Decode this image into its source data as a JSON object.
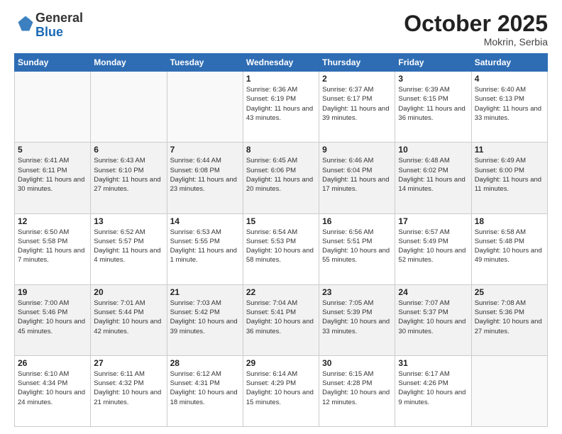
{
  "header": {
    "logo_general": "General",
    "logo_blue": "Blue",
    "month": "October 2025",
    "location": "Mokrin, Serbia"
  },
  "days_of_week": [
    "Sunday",
    "Monday",
    "Tuesday",
    "Wednesday",
    "Thursday",
    "Friday",
    "Saturday"
  ],
  "weeks": [
    [
      {
        "day": "",
        "sunrise": "",
        "sunset": "",
        "daylight": ""
      },
      {
        "day": "",
        "sunrise": "",
        "sunset": "",
        "daylight": ""
      },
      {
        "day": "",
        "sunrise": "",
        "sunset": "",
        "daylight": ""
      },
      {
        "day": "1",
        "sunrise": "Sunrise: 6:36 AM",
        "sunset": "Sunset: 6:19 PM",
        "daylight": "Daylight: 11 hours and 43 minutes."
      },
      {
        "day": "2",
        "sunrise": "Sunrise: 6:37 AM",
        "sunset": "Sunset: 6:17 PM",
        "daylight": "Daylight: 11 hours and 39 minutes."
      },
      {
        "day": "3",
        "sunrise": "Sunrise: 6:39 AM",
        "sunset": "Sunset: 6:15 PM",
        "daylight": "Daylight: 11 hours and 36 minutes."
      },
      {
        "day": "4",
        "sunrise": "Sunrise: 6:40 AM",
        "sunset": "Sunset: 6:13 PM",
        "daylight": "Daylight: 11 hours and 33 minutes."
      }
    ],
    [
      {
        "day": "5",
        "sunrise": "Sunrise: 6:41 AM",
        "sunset": "Sunset: 6:11 PM",
        "daylight": "Daylight: 11 hours and 30 minutes."
      },
      {
        "day": "6",
        "sunrise": "Sunrise: 6:43 AM",
        "sunset": "Sunset: 6:10 PM",
        "daylight": "Daylight: 11 hours and 27 minutes."
      },
      {
        "day": "7",
        "sunrise": "Sunrise: 6:44 AM",
        "sunset": "Sunset: 6:08 PM",
        "daylight": "Daylight: 11 hours and 23 minutes."
      },
      {
        "day": "8",
        "sunrise": "Sunrise: 6:45 AM",
        "sunset": "Sunset: 6:06 PM",
        "daylight": "Daylight: 11 hours and 20 minutes."
      },
      {
        "day": "9",
        "sunrise": "Sunrise: 6:46 AM",
        "sunset": "Sunset: 6:04 PM",
        "daylight": "Daylight: 11 hours and 17 minutes."
      },
      {
        "day": "10",
        "sunrise": "Sunrise: 6:48 AM",
        "sunset": "Sunset: 6:02 PM",
        "daylight": "Daylight: 11 hours and 14 minutes."
      },
      {
        "day": "11",
        "sunrise": "Sunrise: 6:49 AM",
        "sunset": "Sunset: 6:00 PM",
        "daylight": "Daylight: 11 hours and 11 minutes."
      }
    ],
    [
      {
        "day": "12",
        "sunrise": "Sunrise: 6:50 AM",
        "sunset": "Sunset: 5:58 PM",
        "daylight": "Daylight: 11 hours and 7 minutes."
      },
      {
        "day": "13",
        "sunrise": "Sunrise: 6:52 AM",
        "sunset": "Sunset: 5:57 PM",
        "daylight": "Daylight: 11 hours and 4 minutes."
      },
      {
        "day": "14",
        "sunrise": "Sunrise: 6:53 AM",
        "sunset": "Sunset: 5:55 PM",
        "daylight": "Daylight: 11 hours and 1 minute."
      },
      {
        "day": "15",
        "sunrise": "Sunrise: 6:54 AM",
        "sunset": "Sunset: 5:53 PM",
        "daylight": "Daylight: 10 hours and 58 minutes."
      },
      {
        "day": "16",
        "sunrise": "Sunrise: 6:56 AM",
        "sunset": "Sunset: 5:51 PM",
        "daylight": "Daylight: 10 hours and 55 minutes."
      },
      {
        "day": "17",
        "sunrise": "Sunrise: 6:57 AM",
        "sunset": "Sunset: 5:49 PM",
        "daylight": "Daylight: 10 hours and 52 minutes."
      },
      {
        "day": "18",
        "sunrise": "Sunrise: 6:58 AM",
        "sunset": "Sunset: 5:48 PM",
        "daylight": "Daylight: 10 hours and 49 minutes."
      }
    ],
    [
      {
        "day": "19",
        "sunrise": "Sunrise: 7:00 AM",
        "sunset": "Sunset: 5:46 PM",
        "daylight": "Daylight: 10 hours and 45 minutes."
      },
      {
        "day": "20",
        "sunrise": "Sunrise: 7:01 AM",
        "sunset": "Sunset: 5:44 PM",
        "daylight": "Daylight: 10 hours and 42 minutes."
      },
      {
        "day": "21",
        "sunrise": "Sunrise: 7:03 AM",
        "sunset": "Sunset: 5:42 PM",
        "daylight": "Daylight: 10 hours and 39 minutes."
      },
      {
        "day": "22",
        "sunrise": "Sunrise: 7:04 AM",
        "sunset": "Sunset: 5:41 PM",
        "daylight": "Daylight: 10 hours and 36 minutes."
      },
      {
        "day": "23",
        "sunrise": "Sunrise: 7:05 AM",
        "sunset": "Sunset: 5:39 PM",
        "daylight": "Daylight: 10 hours and 33 minutes."
      },
      {
        "day": "24",
        "sunrise": "Sunrise: 7:07 AM",
        "sunset": "Sunset: 5:37 PM",
        "daylight": "Daylight: 10 hours and 30 minutes."
      },
      {
        "day": "25",
        "sunrise": "Sunrise: 7:08 AM",
        "sunset": "Sunset: 5:36 PM",
        "daylight": "Daylight: 10 hours and 27 minutes."
      }
    ],
    [
      {
        "day": "26",
        "sunrise": "Sunrise: 6:10 AM",
        "sunset": "Sunset: 4:34 PM",
        "daylight": "Daylight: 10 hours and 24 minutes."
      },
      {
        "day": "27",
        "sunrise": "Sunrise: 6:11 AM",
        "sunset": "Sunset: 4:32 PM",
        "daylight": "Daylight: 10 hours and 21 minutes."
      },
      {
        "day": "28",
        "sunrise": "Sunrise: 6:12 AM",
        "sunset": "Sunset: 4:31 PM",
        "daylight": "Daylight: 10 hours and 18 minutes."
      },
      {
        "day": "29",
        "sunrise": "Sunrise: 6:14 AM",
        "sunset": "Sunset: 4:29 PM",
        "daylight": "Daylight: 10 hours and 15 minutes."
      },
      {
        "day": "30",
        "sunrise": "Sunrise: 6:15 AM",
        "sunset": "Sunset: 4:28 PM",
        "daylight": "Daylight: 10 hours and 12 minutes."
      },
      {
        "day": "31",
        "sunrise": "Sunrise: 6:17 AM",
        "sunset": "Sunset: 4:26 PM",
        "daylight": "Daylight: 10 hours and 9 minutes."
      },
      {
        "day": "",
        "sunrise": "",
        "sunset": "",
        "daylight": ""
      }
    ]
  ]
}
